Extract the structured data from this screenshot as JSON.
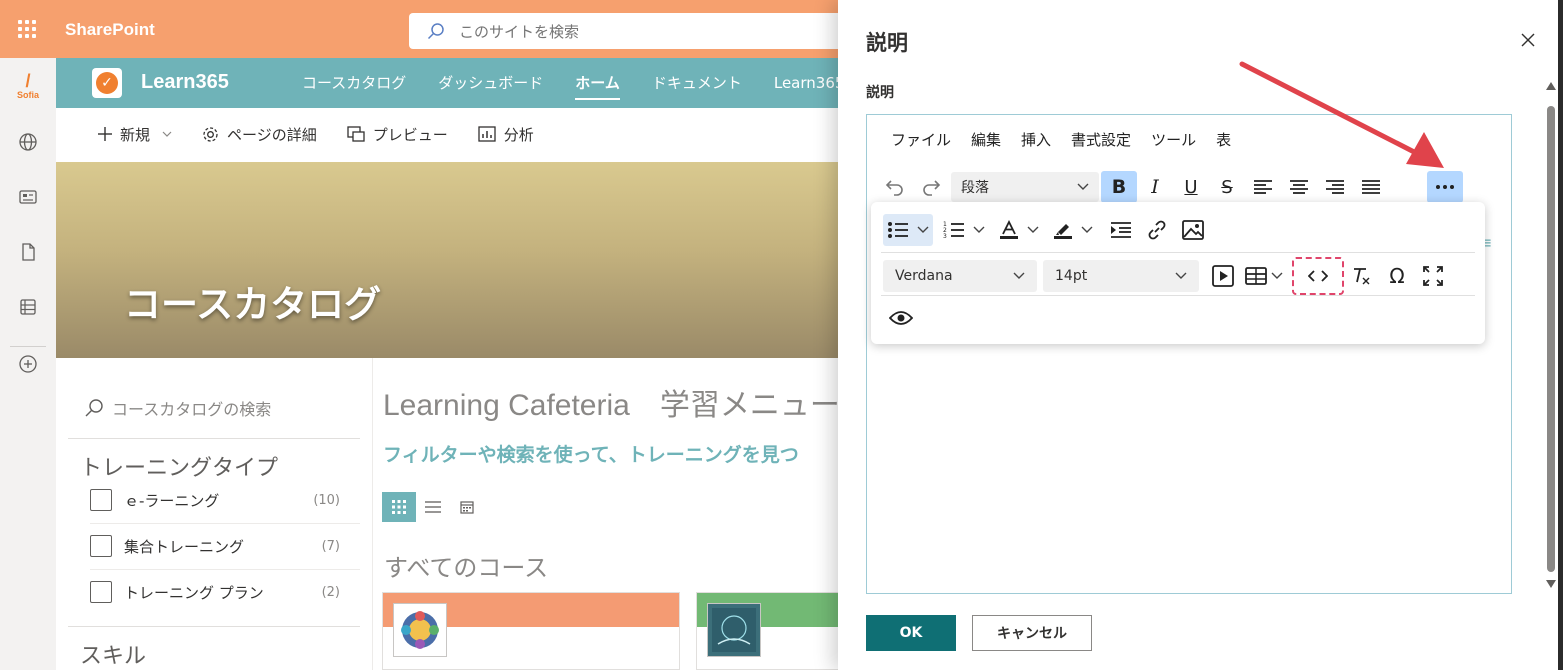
{
  "suite": {
    "brand": "SharePoint",
    "search_placeholder": "このサイトを検索"
  },
  "rail": {
    "logo_text": "Sofia"
  },
  "site": {
    "title": "Learn365",
    "nav": [
      {
        "label": "コースカタログ"
      },
      {
        "label": "ダッシュボード"
      },
      {
        "label": "ホーム",
        "active": true
      },
      {
        "label": "ドキュメント"
      },
      {
        "label": "Learn365"
      }
    ]
  },
  "commands": {
    "new": "新規",
    "page_details": "ページの詳細",
    "preview": "プレビュー",
    "analytics": "分析"
  },
  "hero": {
    "title": "コースカタログ"
  },
  "filters": {
    "search_placeholder": "コースカタログの検索",
    "training_type_heading": "トレーニングタイプ",
    "items": [
      {
        "label": "ｅ-ラーニング",
        "count": "(10)"
      },
      {
        "label": "集合トレーニング",
        "count": "(7)"
      },
      {
        "label": "トレーニング プラン",
        "count": "(2)"
      }
    ],
    "skill_heading": "スキル"
  },
  "catalog": {
    "title": "Learning Cafeteria　学習メニュー",
    "subtitle": "フィルターや検索を使って、トレーニングを見つ",
    "all_courses": "すべてのコース"
  },
  "panel": {
    "title": "説明",
    "field_label": "説明",
    "menu": [
      "ファイル",
      "編集",
      "挿入",
      "書式設定",
      "ツール",
      "表"
    ],
    "paragraph_select": "段落",
    "font_family": "Verdana",
    "font_size": "14pt",
    "ok_label": "OK",
    "cancel_label": "キャンセル"
  },
  "colors": {
    "suite_bar": "#f6a06e",
    "site_header": "#6fb3b8",
    "accent": "#0f6f74",
    "active_tool": "#b4d7ff",
    "annotation_red": "#e0434b"
  }
}
